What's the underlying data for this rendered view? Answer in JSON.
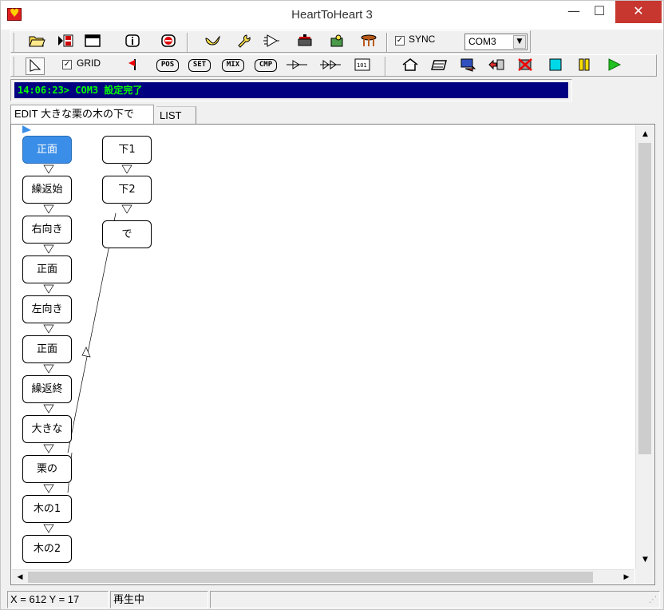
{
  "window": {
    "title": "HeartToHeart 3"
  },
  "toolbar1": {
    "sync_label": "SYNC",
    "sync_checked": true,
    "com_port": "COM3"
  },
  "toolbar2": {
    "grid_label": "GRID",
    "grid_checked": true,
    "pos_label": "POS",
    "set_label": "SET",
    "mix_label": "MIX",
    "cmp_label": "CMP"
  },
  "status_line": "14:06:23> COM3 設定完了",
  "tabs": [
    {
      "label": "EDIT 大きな栗の木の下で",
      "active": true
    },
    {
      "label": "LIST",
      "active": false
    }
  ],
  "nodes": {
    "col1": [
      "正面",
      "繰返始",
      "右向き",
      "正面",
      "左向き",
      "正面",
      "繰返終",
      "大きな",
      "栗の",
      "木の1",
      "木の2"
    ],
    "col2": [
      "下1",
      "下2",
      "で"
    ],
    "selected": "正面"
  },
  "statusbar": {
    "coords": "X = 612  Y = 17",
    "state": "再生中"
  }
}
